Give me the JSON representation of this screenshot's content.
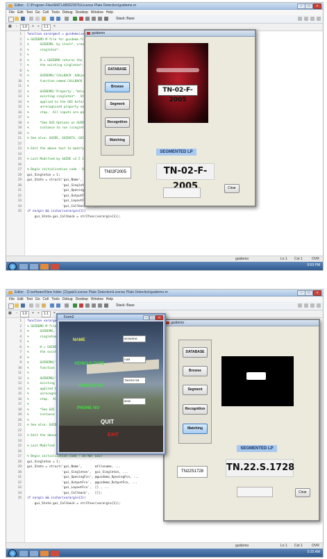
{
  "screens": [
    {
      "window_title": "Editor - C:\\Program Files\\MATLAB\\R2007b\\License Plate Detection\\guidemo.m",
      "menu": [
        "File",
        "Edit",
        "Text",
        "Go",
        "Cell",
        "Tools",
        "Debug",
        "Desktop",
        "Window",
        "Help"
      ],
      "stack_label": "Stack: Base",
      "cell_bar": {
        "minus": "-",
        "value1": "1.0",
        "plus": "+",
        "div": "÷",
        "value2": "1.1",
        "x": "×"
      },
      "line_numbers": [
        "1",
        "2",
        "3",
        "4",
        "5",
        "6",
        "7",
        "8",
        "9",
        "10",
        "11",
        "12",
        "13",
        "14",
        "15",
        "16",
        "17",
        "18",
        "19",
        "20",
        "21",
        "22",
        "23",
        "24",
        "25",
        "26",
        "27",
        "28",
        "29",
        "30",
        "31",
        "32",
        "33",
        "34",
        "35"
      ],
      "code_lines": [
        {
          "t": "function varargout = guidemo(var",
          "c": "kw"
        },
        {
          "t": "% GUIDEMO M-file for guidemo.fig",
          "c": "cm"
        },
        {
          "t": "%      GUIDEMO, by itself, create",
          "c": "cm"
        },
        {
          "t": "%      singleton*.",
          "c": "cm"
        },
        {
          "t": "%",
          "c": "cm"
        },
        {
          "t": "%      H = GUIDEMO returns the h",
          "c": "cm"
        },
        {
          "t": "%      the existing singleton*.",
          "c": "cm"
        },
        {
          "t": "%",
          "c": "cm"
        },
        {
          "t": "%      GUIDEMO('CALLBACK',hObjec",
          "c": "cm"
        },
        {
          "t": "%      function named CALLBACK i",
          "c": "cm"
        },
        {
          "t": "%",
          "c": "cm"
        },
        {
          "t": "%      GUIDEMO('Property','Value",
          "c": "cm"
        },
        {
          "t": "%      existing singleton*.  Sta",
          "c": "cm"
        },
        {
          "t": "%      applied to the GUI before",
          "c": "cm"
        },
        {
          "t": "%      unrecognized property nam",
          "c": "cm"
        },
        {
          "t": "%      stop.  All inputs are pas",
          "c": "cm"
        },
        {
          "t": "%",
          "c": "cm"
        },
        {
          "t": "%      *See GUI Options on GUIDE",
          "c": "cm"
        },
        {
          "t": "%      instance to run (singleto",
          "c": "cm"
        },
        {
          "t": "%",
          "c": "cm"
        },
        {
          "t": "% See also: GUIDE, GUIDATA, GUIHA",
          "c": "cm"
        },
        {
          "t": "",
          "c": "cm"
        },
        {
          "t": "% Edit the above text to modify t",
          "c": "cm"
        },
        {
          "t": "",
          "c": "cm"
        },
        {
          "t": "% Last Modified by GUIDE v2.5 12-",
          "c": "cm"
        },
        {
          "t": "",
          "c": "cm"
        },
        {
          "t": "% Begin initialization code - DO",
          "c": "cm"
        },
        {
          "t": "gui_Singleton = 1;",
          "c": "pl"
        },
        {
          "t": "gui_State = struct('gui_Name',",
          "c": "pl"
        },
        {
          "t": "                   'gui_Singleton',",
          "c": "pl"
        },
        {
          "t": "                   'gui_OpeningFc",
          "c": "pl"
        },
        {
          "t": "                   'gui_OutputFcn', @guidemo_OutputFcn, ...",
          "c": "pl"
        },
        {
          "t": "                   'gui_LayoutFcn', [] , ...",
          "c": "pl"
        },
        {
          "t": "                   'gui_Callback',  []);",
          "c": "pl"
        },
        {
          "t": "if nargin && ischar(varargin{1})",
          "c": "kw"
        },
        {
          "t": "    gui_State.gui_Callback = str2func(varargin{1});",
          "c": "pl"
        }
      ],
      "status": {
        "file": "guidemo",
        "ln": "Ln  1",
        "col": "Col  1",
        "ovr": "OVR"
      },
      "tray_time": "9:59 PM",
      "gui": {
        "title": "guidemo",
        "buttons": [
          "DATABASE",
          "Browse",
          "Segment",
          "Recognition",
          "Matching"
        ],
        "seg_label": "SEGMENTED LP",
        "plate_text": "TN-02-F-2005",
        "car_plate": "TN-02-F-2005",
        "recognized": "TN02F2005",
        "clear": "Clear"
      }
    },
    {
      "window_title": "Editor - D:\\software\\New folder (2)\\gate\\License Plate Detection\\License Plate Detection\\guidemo.m",
      "menu": [
        "File",
        "Edit",
        "Text",
        "Go",
        "Cell",
        "Tools",
        "Debug",
        "Desktop",
        "Window",
        "Help"
      ],
      "stack_label": "Stack: Base",
      "cell_bar": {
        "minus": "-",
        "value1": "1.0",
        "plus": "+",
        "div": "÷",
        "value2": "1.1",
        "x": "×"
      },
      "line_numbers": [
        "1",
        "2",
        "3",
        "4",
        "5",
        "6",
        "7",
        "8",
        "9",
        "10",
        "11",
        "12",
        "13",
        "14",
        "15",
        "16",
        "17",
        "18",
        "19",
        "20",
        "21",
        "22",
        "23",
        "24",
        "25",
        "26",
        "27",
        "28",
        "29",
        "30",
        "31",
        "32",
        "33",
        "34",
        "35"
      ],
      "code_lines": [
        {
          "t": "function varargout",
          "c": "kw"
        },
        {
          "t": "% GUIDEMO M-file",
          "c": "cm"
        },
        {
          "t": "%      GUIDEMO, b",
          "c": "cm"
        },
        {
          "t": "%      singleton*",
          "c": "cm"
        },
        {
          "t": "%",
          "c": "cm"
        },
        {
          "t": "%      H = GUIDEMO",
          "c": "cm"
        },
        {
          "t": "%      the existi",
          "c": "cm"
        },
        {
          "t": "%",
          "c": "cm"
        },
        {
          "t": "%      GUIDEMO('C",
          "c": "cm"
        },
        {
          "t": "%      function n",
          "c": "cm"
        },
        {
          "t": "%",
          "c": "cm"
        },
        {
          "t": "%      GUIDEMO('P",
          "c": "cm"
        },
        {
          "t": "%      existing s",
          "c": "cm"
        },
        {
          "t": "%      applied to",
          "c": "cm"
        },
        {
          "t": "%      unrecogniz",
          "c": "cm"
        },
        {
          "t": "%      stop.  All",
          "c": "cm"
        },
        {
          "t": "%",
          "c": "cm"
        },
        {
          "t": "%      *See GUI O",
          "c": "cm"
        },
        {
          "t": "%      instance t",
          "c": "cm"
        },
        {
          "t": "%",
          "c": "cm"
        },
        {
          "t": "% See also: GUIDE,",
          "c": "cm"
        },
        {
          "t": "",
          "c": "cm"
        },
        {
          "t": "% Edit the above text to modify the response to help guidemo",
          "c": "cm"
        },
        {
          "t": "",
          "c": "cm"
        },
        {
          "t": "% Last Modified by GUIDE v2.5 12-Oct-2013 10:55:54",
          "c": "cm"
        },
        {
          "t": "",
          "c": "cm"
        },
        {
          "t": "% Begin initialization code - DO NOT EDIT",
          "c": "cm"
        },
        {
          "t": "gui_Singleton = 1;",
          "c": "pl"
        },
        {
          "t": "gui_State = struct('gui_Name',       mfilename, ...",
          "c": "pl"
        },
        {
          "t": "                   'gui_Singleton',  gui_Singleton, ...",
          "c": "pl"
        },
        {
          "t": "                   'gui_OpeningFcn', @guidemo_OpeningFcn, ...",
          "c": "pl"
        },
        {
          "t": "                   'gui_OutputFcn',  @guidemo_OutputFcn, ...",
          "c": "pl"
        },
        {
          "t": "                   'gui_LayoutFcn',  [] , ...",
          "c": "pl"
        },
        {
          "t": "                   'gui_Callback',   []);",
          "c": "pl"
        },
        {
          "t": "if nargin && ischar(varargin{1})",
          "c": "kw"
        },
        {
          "t": "    gui_State.gui_Callback = str2func(varargin{1});",
          "c": "pl"
        }
      ],
      "status": {
        "file": "guidemo",
        "ln": "Ln  1",
        "col": "Col  1",
        "ovr": "OVR"
      },
      "tray_time": "5:25 AM",
      "gui": {
        "title": "guidemo",
        "buttons": [
          "DATABASE",
          "Browse",
          "Segment",
          "Recognition",
          "Matching"
        ],
        "seg_label": "SEGMENTED LP",
        "plate_text": "TN.22.S.1728",
        "recognized": "TN22S1728",
        "clear": "Clear"
      },
      "form2": {
        "title": "Form2",
        "labels": [
          "NAME",
          "VEHICLE TYPE",
          "VEHICLE NO",
          "PHONE NO"
        ],
        "values": [
          "MONISHA",
          "CAR",
          "TN22S1728",
          "8095"
        ],
        "quit": "QUIT",
        "exit": "EXIT"
      }
    }
  ]
}
